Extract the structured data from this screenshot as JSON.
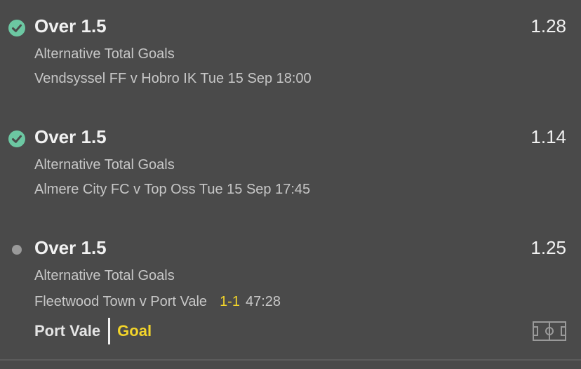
{
  "colors": {
    "background": "#4a4a4a",
    "settled_check": "#6cc7a2",
    "pending_dot": "#9a9a9a",
    "score_yellow": "#f2d42a"
  },
  "selections": [
    {
      "status_icon": "check-circle-icon",
      "title": "Over 1.5",
      "odds": "1.28",
      "market": "Alternative Total Goals",
      "event": "Vendsyssel FF v Hobro IK Tue 15 Sep 18:00"
    },
    {
      "status_icon": "check-circle-icon",
      "title": "Over 1.5",
      "odds": "1.14",
      "market": "Alternative Total Goals",
      "event": "Almere City FC v Top Oss Tue 15 Sep 17:45"
    },
    {
      "status_icon": "pending-dot-icon",
      "title": "Over 1.5",
      "odds": "1.25",
      "market": "Alternative Total Goals",
      "event": "Fleetwood Town v Port Vale",
      "score": "1-1",
      "clock": "47:28",
      "incident_team": "Port Vale",
      "incident_type": "Goal",
      "pitch_icon": "pitch-icon"
    }
  ]
}
